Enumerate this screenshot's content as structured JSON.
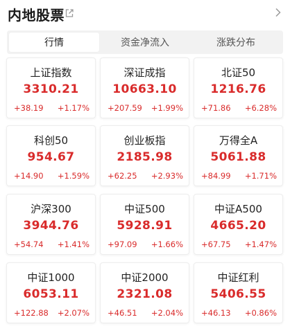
{
  "header": {
    "title": "内地股票"
  },
  "tabs": [
    {
      "label": "行情",
      "active": true
    },
    {
      "label": "资金净流入",
      "active": false
    },
    {
      "label": "涨跌分布",
      "active": false
    }
  ],
  "indices": [
    {
      "name": "上证指数",
      "price": "3310.21",
      "change": "+38.19",
      "pct": "+1.17%"
    },
    {
      "name": "深证成指",
      "price": "10663.10",
      "change": "+207.59",
      "pct": "+1.99%"
    },
    {
      "name": "北证50",
      "price": "1216.76",
      "change": "+71.86",
      "pct": "+6.28%"
    },
    {
      "name": "科创50",
      "price": "954.67",
      "change": "+14.90",
      "pct": "+1.59%"
    },
    {
      "name": "创业板指",
      "price": "2185.98",
      "change": "+62.25",
      "pct": "+2.93%"
    },
    {
      "name": "万得全A",
      "price": "5061.88",
      "change": "+84.99",
      "pct": "+1.71%"
    },
    {
      "name": "沪深300",
      "price": "3944.76",
      "change": "+54.74",
      "pct": "+1.41%"
    },
    {
      "name": "中证500",
      "price": "5928.91",
      "change": "+97.09",
      "pct": "+1.66%"
    },
    {
      "name": "中证A500",
      "price": "4665.20",
      "change": "+67.75",
      "pct": "+1.47%"
    },
    {
      "name": "中证1000",
      "price": "6053.11",
      "change": "+122.88",
      "pct": "+2.07%"
    },
    {
      "name": "中证2000",
      "price": "2321.08",
      "change": "+46.51",
      "pct": "+2.04%"
    },
    {
      "name": "中证红利",
      "price": "5406.55",
      "change": "+46.13",
      "pct": "+0.86%"
    }
  ],
  "colors": {
    "up": "#d92b2b",
    "text": "#222222",
    "tab_bg": "#f2f2f2"
  },
  "icons": {
    "share": "share-icon",
    "more": "chevron-right-icon"
  }
}
